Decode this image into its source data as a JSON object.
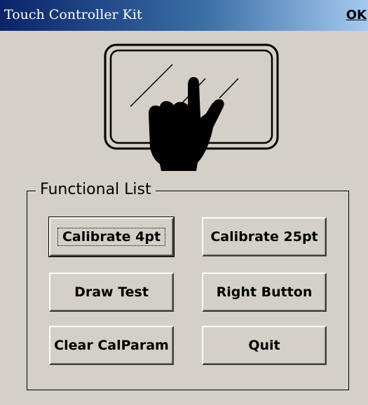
{
  "window": {
    "title": "Touch Controller Kit",
    "ok_label": "OK"
  },
  "illustration": {
    "icon": "touch-hand-icon"
  },
  "group": {
    "label": "Functional List"
  },
  "buttons": {
    "calibrate_4pt": "Calibrate 4pt",
    "calibrate_25pt": "Calibrate 25pt",
    "draw_test": "Draw Test",
    "right_button": "Right Button",
    "clear_calparam": "Clear CalParam",
    "quit": "Quit"
  },
  "colors": {
    "face": "#d4d0c8",
    "title_start": "#0a246a",
    "title_end": "#a6caf0"
  }
}
